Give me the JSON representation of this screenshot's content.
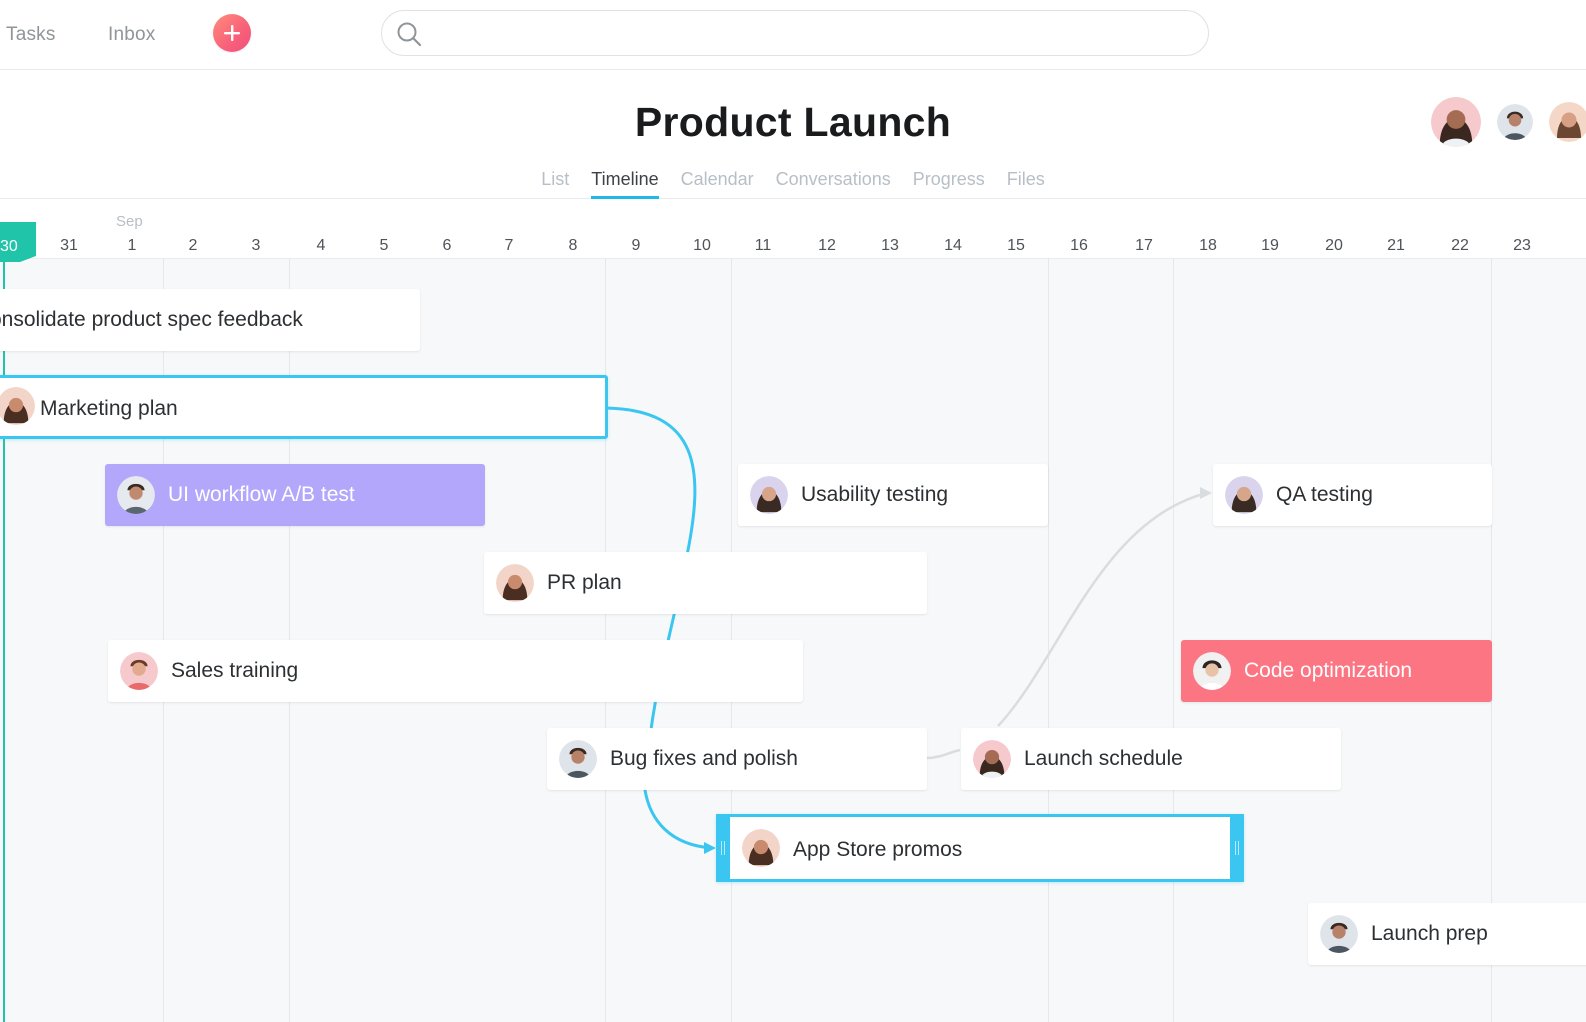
{
  "nav": {
    "tasks": "Tasks",
    "inbox": "Inbox"
  },
  "search": {
    "placeholder": "",
    "value": ""
  },
  "project": {
    "title": "Product Launch",
    "tabs": [
      {
        "label": "List",
        "active": false
      },
      {
        "label": "Timeline",
        "active": true
      },
      {
        "label": "Calendar",
        "active": false
      },
      {
        "label": "Conversations",
        "active": false
      },
      {
        "label": "Progress",
        "active": false
      },
      {
        "label": "Files",
        "active": false
      }
    ]
  },
  "timeline": {
    "month_label": "Sep",
    "today_label": "30",
    "days": [
      "31",
      "1",
      "2",
      "3",
      "4",
      "5",
      "6",
      "7",
      "8",
      "9",
      "10",
      "11",
      "12",
      "13",
      "14",
      "15",
      "16",
      "17",
      "18",
      "19",
      "20",
      "21",
      "22",
      "23"
    ],
    "tasks": [
      {
        "label": "onsolidate product spec feedback"
      },
      {
        "label": "Marketing plan"
      },
      {
        "label": "UI workflow A/B test"
      },
      {
        "label": "Usability testing"
      },
      {
        "label": "QA testing"
      },
      {
        "label": "PR plan"
      },
      {
        "label": "Sales training"
      },
      {
        "label": "Code optimization"
      },
      {
        "label": "Bug fixes and polish"
      },
      {
        "label": "Launch schedule"
      },
      {
        "label": "App Store promos"
      },
      {
        "label": "Launch prep"
      }
    ]
  },
  "colors": {
    "accent": "#20b8e8",
    "today": "#20c4a8",
    "purple_task": "#b2a7fa",
    "red_task": "#fc7583",
    "add_button": "#f8607a"
  }
}
